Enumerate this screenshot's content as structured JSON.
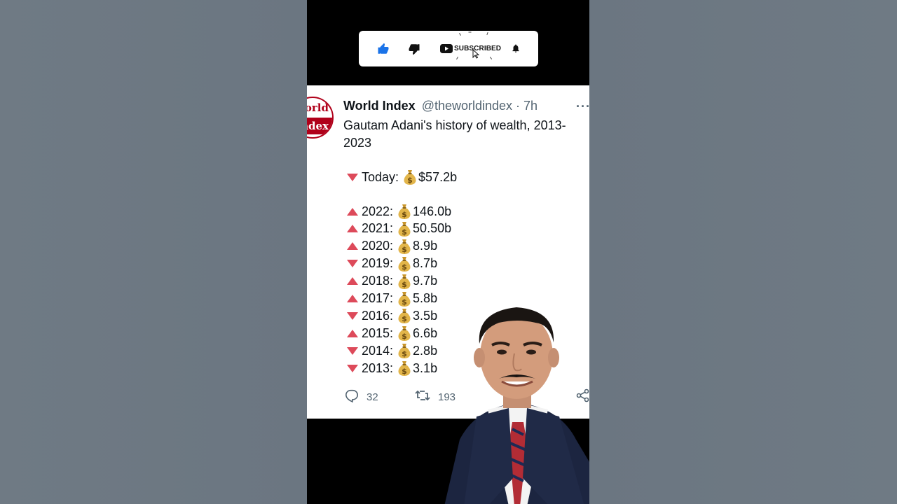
{
  "subscribe": {
    "label": "SUBSCRIBED"
  },
  "tweet": {
    "avatar_line1": "orld",
    "avatar_line2": "ndex",
    "name": "World Index",
    "handle": "@theworldindex",
    "separator": " · ",
    "time": "7h",
    "more": "···",
    "text": "Gautam Adani's history of wealth, 2013-2023",
    "today": {
      "label": "Today:",
      "value": "$57.2b",
      "trend": "down"
    },
    "years": [
      {
        "label": "2022:",
        "value": "146.0b",
        "trend": "up"
      },
      {
        "label": "2021:",
        "value": "50.50b",
        "trend": "up"
      },
      {
        "label": "2020:",
        "value": "8.9b",
        "trend": "up"
      },
      {
        "label": "2019:",
        "value": "8.7b",
        "trend": "down"
      },
      {
        "label": "2018:",
        "value": "9.7b",
        "trend": "up"
      },
      {
        "label": "2017:",
        "value": "5.8b",
        "trend": "up"
      },
      {
        "label": "2016:",
        "value": "3.5b",
        "trend": "down"
      },
      {
        "label": "2015:",
        "value": "6.6b",
        "trend": "up"
      },
      {
        "label": "2014:",
        "value": "2.8b",
        "trend": "down"
      },
      {
        "label": "2013:",
        "value": "3.1b",
        "trend": "down"
      }
    ],
    "replies": "32",
    "retweets": "193"
  },
  "colors": {
    "trend": "#dd4a5a",
    "like_active": "#1a73e8",
    "brand_red": "#b0001a"
  }
}
